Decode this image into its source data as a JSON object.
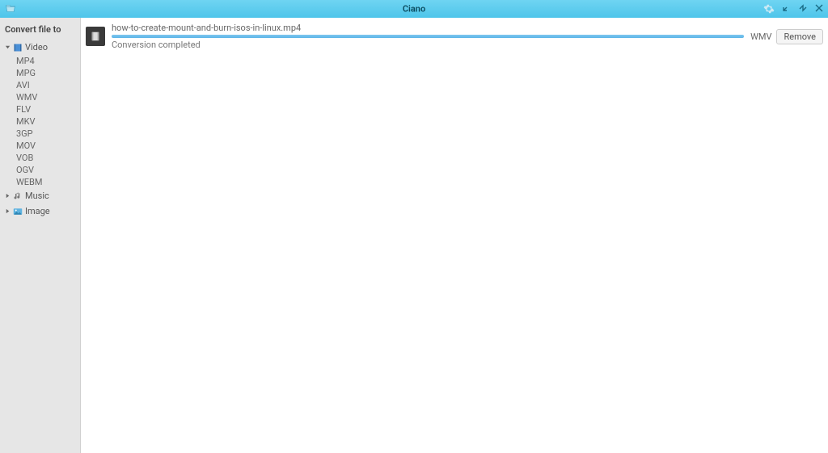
{
  "titlebar": {
    "app_title": "Ciano"
  },
  "sidebar": {
    "heading": "Convert file to",
    "categories": [
      {
        "label": "Video",
        "expanded": true,
        "icon": "film-icon",
        "children": [
          "MP4",
          "MPG",
          "AVI",
          "WMV",
          "FLV",
          "MKV",
          "3GP",
          "MOV",
          "VOB",
          "OGV",
          "WEBM"
        ]
      },
      {
        "label": "Music",
        "expanded": false,
        "icon": "music-icon",
        "children": []
      },
      {
        "label": "Image",
        "expanded": false,
        "icon": "image-icon",
        "children": []
      }
    ]
  },
  "main": {
    "files": [
      {
        "filename": "how-to-create-mount-and-burn-isos-in-linux.mp4",
        "status": "Conversion completed",
        "progress_pct": 100,
        "target_format": "WMV",
        "remove_label": "Remove"
      }
    ]
  }
}
